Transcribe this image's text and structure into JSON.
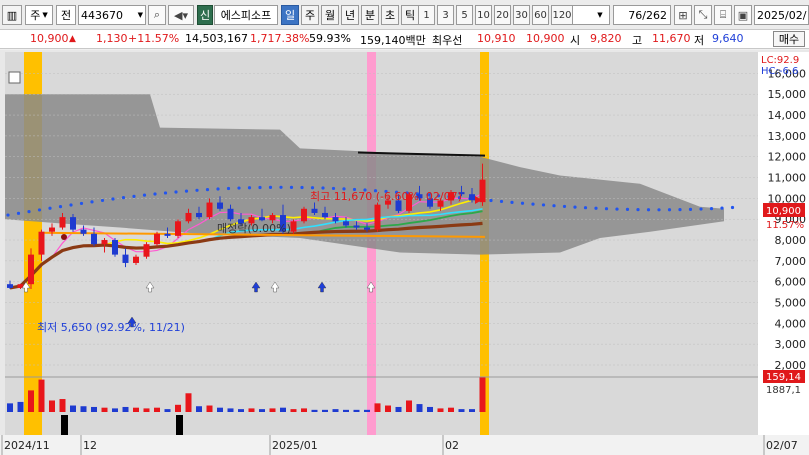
{
  "toolbar": {
    "market_label": "주",
    "market_dropdown_arrow": "▼",
    "prefix_label": "전",
    "stock_code": "443670",
    "stock_name": "에스피소프",
    "credit_label": "신",
    "periods": [
      "일",
      "주",
      "월",
      "년",
      "분",
      "초",
      "틱"
    ],
    "active_period": "일",
    "intervals": [
      "1",
      "3",
      "5",
      "10",
      "20",
      "30",
      "60",
      "120"
    ],
    "page_counter": "76/262",
    "end_date": "2025/02/"
  },
  "quote": {
    "price": "10,900",
    "change_arrow": "▲",
    "change": "1,130",
    "change_pct": "+11.57%",
    "volume": "14,503,167",
    "volume_pct": "1,717.38%",
    "turnover_pct": "59.93%",
    "amount": "159,140백만",
    "priority_label": "최우선",
    "ask": "10,910",
    "bid": "10,900",
    "open_label": "시",
    "open": "9,820",
    "high_label": "고",
    "high": "11,670",
    "low_label": "저",
    "low": "9,640",
    "buy_label": "매수"
  },
  "chart": {
    "lc_label": "LC:92.9",
    "hc_label": "HC:-6.6",
    "y_ticks": [
      "16,000",
      "15,000",
      "14,000",
      "13,000",
      "12,000",
      "11,000",
      "10,000",
      "9,000",
      "8,000",
      "7,000",
      "6,000",
      "5,000",
      "4,000",
      "3,000",
      "2,000"
    ],
    "current_price_tag": "10,900",
    "current_pct_tag": "11.57%",
    "volume_tag": "159,14",
    "volume_pct_tag": "1887,1",
    "high_annotation": "최고 11,670 (-6.60%, 02/07)",
    "low_annotation": "최저 5,650 (92.92%, 11/21)",
    "event_label": "매정락(0.00%)",
    "x_labels": [
      "2024/11",
      "12",
      "2025/01",
      "02",
      "02/07"
    ],
    "colors": {
      "up": "#e8161b",
      "down": "#1e3bd0",
      "highlight_gold": "#ffc000",
      "highlight_pink": "#ff9ccf",
      "cloud": "#8a8a8a",
      "ma_brown": "#8b3a14"
    }
  },
  "chart_data": {
    "type": "candlestick",
    "y_range": [
      2000,
      16500
    ],
    "candles": [
      [
        5880,
        6050,
        5650,
        5700
      ],
      [
        5700,
        5900,
        5650,
        5880
      ],
      [
        5880,
        7600,
        5650,
        7300
      ],
      [
        7300,
        8500,
        7000,
        8400
      ],
      [
        8400,
        8800,
        8200,
        8600
      ],
      [
        8600,
        9300,
        8500,
        9100
      ],
      [
        9100,
        9250,
        8400,
        8500
      ],
      [
        8500,
        8700,
        8200,
        8300
      ],
      [
        8300,
        8600,
        7700,
        7800
      ],
      [
        7800,
        8100,
        7400,
        8000
      ],
      [
        8000,
        8100,
        7200,
        7300
      ],
      [
        7300,
        7600,
        6700,
        6900
      ],
      [
        6900,
        7300,
        6800,
        7200
      ],
      [
        7200,
        7900,
        7100,
        7800
      ],
      [
        7800,
        8400,
        7700,
        8300
      ],
      [
        8300,
        8600,
        8100,
        8200
      ],
      [
        8200,
        9000,
        8100,
        8900
      ],
      [
        8900,
        9500,
        8800,
        9300
      ],
      [
        9300,
        9600,
        9000,
        9100
      ],
      [
        9100,
        10000,
        9000,
        9800
      ],
      [
        9800,
        10100,
        9400,
        9500
      ],
      [
        9500,
        9700,
        8900,
        9000
      ],
      [
        9000,
        9300,
        8700,
        8800
      ],
      [
        8800,
        9200,
        8700,
        9100
      ],
      [
        9100,
        9500,
        8900,
        8950
      ],
      [
        8950,
        9300,
        8800,
        9200
      ],
      [
        9200,
        9700,
        8300,
        8400
      ],
      [
        8400,
        9000,
        8300,
        8900
      ],
      [
        8900,
        9600,
        8800,
        9500
      ],
      [
        9500,
        9800,
        9200,
        9300
      ],
      [
        9300,
        9600,
        9000,
        9100
      ],
      [
        9100,
        9300,
        8800,
        8900
      ],
      [
        8900,
        9100,
        8600,
        8700
      ],
      [
        8700,
        8900,
        8500,
        8600
      ],
      [
        8600,
        8800,
        8400,
        8500
      ],
      [
        8500,
        9800,
        8400,
        9700
      ],
      [
        9700,
        10100,
        9500,
        9900
      ],
      [
        9900,
        10200,
        9300,
        9400
      ],
      [
        9400,
        10300,
        9300,
        10200
      ],
      [
        10200,
        10600,
        9900,
        10000
      ],
      [
        10000,
        10300,
        9500,
        9600
      ],
      [
        9600,
        10000,
        9400,
        9900
      ],
      [
        9900,
        10400,
        9700,
        10300
      ],
      [
        10300,
        10600,
        10100,
        10200
      ],
      [
        10200,
        10500,
        9800,
        9900
      ],
      [
        9820,
        11670,
        9640,
        10900
      ]
    ],
    "volume_up_down": [
      "d",
      "d",
      "u",
      "u",
      "u",
      "u",
      "d",
      "d",
      "d",
      "u",
      "d",
      "d",
      "u",
      "u",
      "u",
      "d",
      "u",
      "u",
      "d",
      "u",
      "d",
      "d",
      "d",
      "u",
      "d",
      "u",
      "d",
      "u",
      "u",
      "d",
      "d",
      "d",
      "d",
      "d",
      "d",
      "u",
      "u",
      "d",
      "u",
      "d",
      "d",
      "u",
      "u",
      "d",
      "d",
      "u"
    ],
    "volumes": [
      1.2,
      1.4,
      3.0,
      4.5,
      1.6,
      1.8,
      0.9,
      0.8,
      0.7,
      0.6,
      0.5,
      0.7,
      0.6,
      0.5,
      0.6,
      0.4,
      1.0,
      2.6,
      0.8,
      0.9,
      0.6,
      0.5,
      0.4,
      0.5,
      0.4,
      0.5,
      0.6,
      0.4,
      0.5,
      0.3,
      0.3,
      0.4,
      0.3,
      0.3,
      0.3,
      1.2,
      0.9,
      0.7,
      1.6,
      1.1,
      0.7,
      0.5,
      0.6,
      0.4,
      0.4,
      4.8
    ]
  }
}
